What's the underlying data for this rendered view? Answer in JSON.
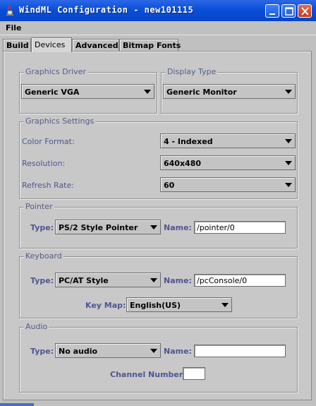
{
  "window": {
    "title": "WindML Configuration - new101115"
  },
  "menubar": {
    "items": [
      {
        "label": "File"
      }
    ]
  },
  "tabs": [
    {
      "label": "Build",
      "active": false
    },
    {
      "label": "Devices",
      "active": true
    },
    {
      "label": "Advanced",
      "active": false
    },
    {
      "label": "Bitmap Fonts",
      "active": false
    }
  ],
  "graphics_driver": {
    "legend": "Graphics Driver",
    "value": "Generic VGA"
  },
  "display_type": {
    "legend": "Display Type",
    "value": "Generic Monitor"
  },
  "graphics_settings": {
    "legend": "Graphics Settings",
    "color_format_label": "Color Format:",
    "color_format_value": "4 - Indexed",
    "resolution_label": "Resolution:",
    "resolution_value": "640x480",
    "refresh_rate_label": "Refresh Rate:",
    "refresh_rate_value": "60"
  },
  "pointer": {
    "legend": "Pointer",
    "type_label": "Type:",
    "type_value": "PS/2 Style Pointer",
    "name_label": "Name:",
    "name_value": "/pointer/0"
  },
  "keyboard": {
    "legend": "Keyboard",
    "type_label": "Type:",
    "type_value": "PC/AT Style",
    "name_label": "Name:",
    "name_value": "/pcConsole/0",
    "keymap_label": "Key Map:",
    "keymap_value": "English(US)"
  },
  "audio": {
    "legend": "Audio",
    "type_label": "Type:",
    "type_value": "No audio",
    "name_label": "Name:",
    "name_value": "",
    "channel_label": "Channel Number:",
    "channel_value": ""
  },
  "colors": {
    "titlebar": "#0a4fd9",
    "label_text": "#4e5694",
    "legend_text": "#565d87",
    "panel_bg": "#c8c8c8"
  },
  "icons": [
    "app-icon",
    "minimize-icon",
    "maximize-icon",
    "close-icon",
    "chevron-down-icon"
  ]
}
